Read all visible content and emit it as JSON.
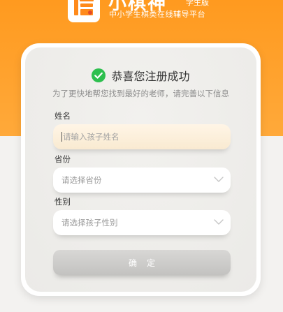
{
  "header": {
    "brand": "小棋神",
    "edition": "学生版",
    "tagline": "中小学生棋类在线辅导平台"
  },
  "card": {
    "title": "恭喜您注册成功",
    "subtitle": "为了更快地帮您找到最好的老师，请完善以下信息"
  },
  "form": {
    "name_label": "姓名",
    "name_placeholder": "请输入孩子姓名",
    "province_label": "省份",
    "province_placeholder": "请选择省份",
    "gender_label": "性别",
    "gender_placeholder": "请选择孩子性别",
    "confirm_label": "确定"
  },
  "colors": {
    "header_orange": "#ff9a1f",
    "success_green": "#2dbf4e",
    "button_gray": "#cdccca"
  },
  "icons": {
    "logo": "chess-logo-icon",
    "success": "check-circle-icon",
    "dropdown": "chevron-down-icon"
  }
}
